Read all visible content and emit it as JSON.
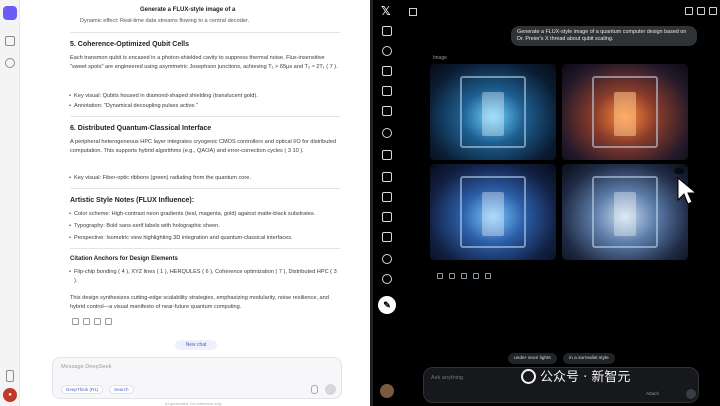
{
  "doc": {
    "request_title": "Generate a FLUX-style image of a",
    "dynamic_line": "Dynamic effect: Real-time data streams flowing to a central decoder.",
    "section5": {
      "title": "5. Coherence-Optimized Qubit Cells",
      "para": "Each transmon qubit is encased in a photon-shielded cavity to suppress thermal noise. Flux-insensitive \"sweet spots\" are engineered using asymmetric Josephson junctions, achieving T₁ > 65µs and T₂ ≈ 2T₁ ( 7 ).",
      "bullets": [
        "Key visual: Qubits housed in diamond-shaped shielding (translucent gold).",
        "Annotation: \"Dynamical decoupling pulses active.\""
      ]
    },
    "section6": {
      "title": "6. Distributed Quantum-Classical Interface",
      "para": "A peripheral heterogeneous HPC layer integrates cryogenic CMOS controllers and optical I/O for distributed computation. This supports hybrid algorithms (e.g., QAOA) and error-correction cycles ( 3 10 ).",
      "bullets": [
        "Key visual: Fiber-optic ribbons (green) radiating from the quantum core."
      ]
    },
    "style_notes": {
      "title": "Artistic Style Notes (FLUX Influence):",
      "bullets": [
        "Color scheme: High-contrast neon gradients (teal, magenta, gold) against matte-black substrates.",
        "Typography: Bold sans-serif labels with holographic sheen.",
        "Perspective: Isometric view highlighting 3D integration and quantum-classical interfaces."
      ]
    },
    "citations": {
      "title": "Citation Anchors for Design Elements",
      "bullets": [
        "Flip-chip bonding ( 4 ), XYZ lines ( 1 ), HERQULES ( 6 ), Coherence optimization ( 7 ), Distributed HPC ( 3 )."
      ]
    },
    "closing": "This design synthesizes cutting-edge scalability strategies, emphasizing modularity, noise resilience, and hybrid control—a visual manifesto of near-future quantum computing."
  },
  "new_chat_label": "New chat",
  "composer": {
    "placeholder": "Message DeepSeek",
    "deepthink_label": "DeepThink (R1)",
    "search_label": "Search"
  },
  "footer_note": "AI-generated, for reference only",
  "grok": {
    "user_message": "Generate a FLUX-style image of a quantum computer design based on Dr. Preier's X thread about qubit scaling.",
    "image_label": "Image",
    "suggestions": [
      "under neon lights",
      "in a surrealist style"
    ],
    "ask_placeholder": "Ask anything",
    "attach_label": "Attach"
  },
  "watermark": "公众号 · 新智元"
}
